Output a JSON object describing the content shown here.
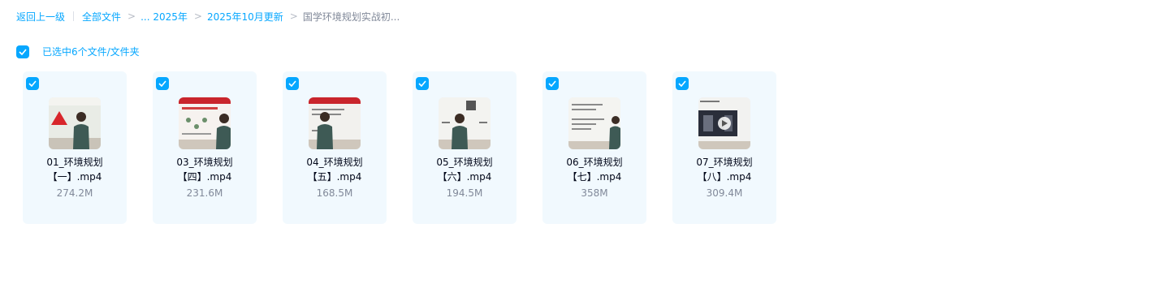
{
  "breadcrumb": {
    "back": "返回上一级",
    "all_files": "全部文件",
    "ellipsis_2025": "... 2025年",
    "oct_update": "2025年10月更新",
    "current": "国学环境规划实战初..."
  },
  "selection": {
    "text": "已选中6个文件/文件夹",
    "all_checked": true
  },
  "files": [
    {
      "line1": "01_环境规划",
      "line2": "【一】.mp4",
      "size": "274.2M",
      "checked": true
    },
    {
      "line1": "03_环境规划",
      "line2": "【四】.mp4",
      "size": "231.6M",
      "checked": true
    },
    {
      "line1": "04_环境规划",
      "line2": "【五】.mp4",
      "size": "168.5M",
      "checked": true
    },
    {
      "line1": "05_环境规划",
      "line2": "【六】.mp4",
      "size": "194.5M",
      "checked": true
    },
    {
      "line1": "06_环境规划",
      "line2": "【七】.mp4",
      "size": "358M",
      "checked": true
    },
    {
      "line1": "07_环境规划",
      "line2": "【八】.mp4",
      "size": "309.4M",
      "checked": true
    }
  ],
  "colors": {
    "accent": "#06a7ff",
    "card_bg": "#f1f9fe",
    "muted": "#818999"
  }
}
